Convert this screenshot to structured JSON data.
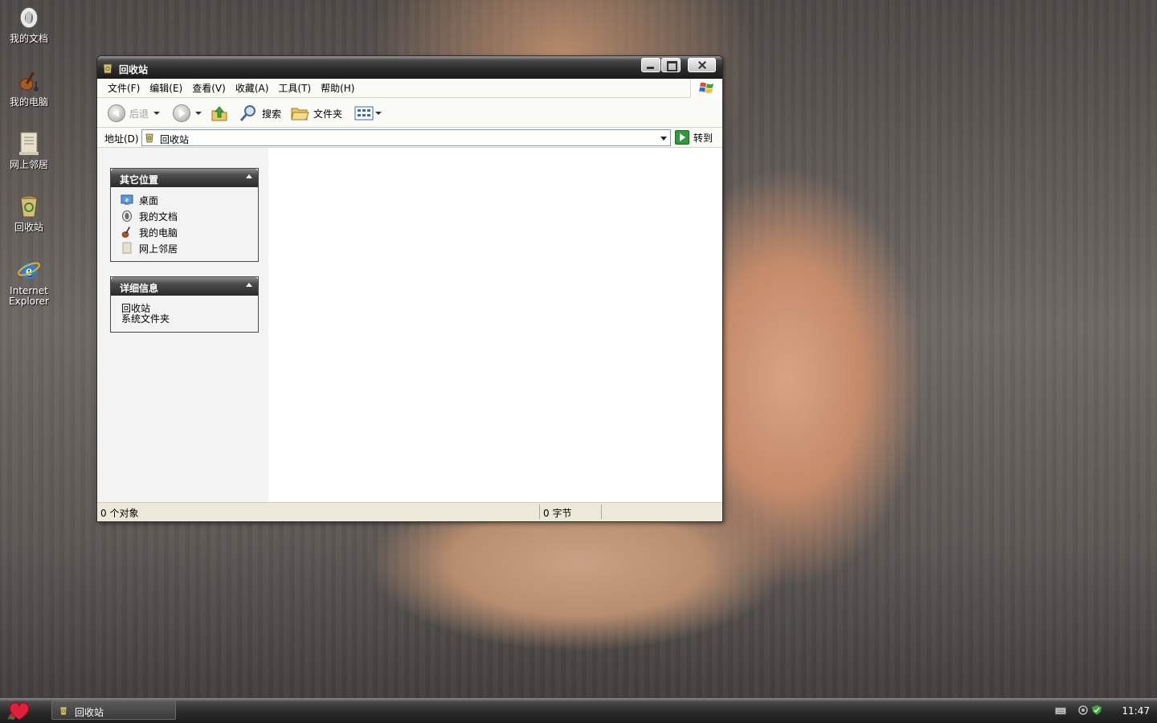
{
  "desktop": {
    "icons": [
      {
        "label": "我的文档",
        "icon": "my-documents-icon"
      },
      {
        "label": "我的电脑",
        "icon": "my-computer-icon"
      },
      {
        "label": "网上邻居",
        "icon": "network-places-icon"
      },
      {
        "label": "回收站",
        "icon": "recycle-bin-icon"
      },
      {
        "label_line1": "Internet",
        "label_line2": "Explorer",
        "icon": "internet-explorer-icon"
      }
    ]
  },
  "window": {
    "title": "回收站",
    "menu": [
      "文件(F)",
      "编辑(E)",
      "查看(V)",
      "收藏(A)",
      "工具(T)",
      "帮助(H)"
    ],
    "toolbar": {
      "back_label": "后退",
      "search_label": "搜索",
      "folders_label": "文件夹"
    },
    "address": {
      "label": "地址(D)",
      "value": "回收站",
      "go_label": "转到"
    },
    "taskpane": {
      "other_places": {
        "title": "其它位置",
        "items": [
          {
            "label": "桌面",
            "icon": "desktop-icon"
          },
          {
            "label": "我的文档",
            "icon": "my-documents-icon"
          },
          {
            "label": "我的电脑",
            "icon": "my-computer-icon"
          },
          {
            "label": "网上邻居",
            "icon": "network-places-icon"
          }
        ]
      },
      "details": {
        "title": "详细信息",
        "name": "回收站",
        "type": "系统文件夹"
      }
    },
    "status": {
      "objects": "0 个对象",
      "size": "0 字节"
    }
  },
  "taskbar": {
    "task_label": "回收站",
    "clock": "11:47"
  },
  "colors": {
    "titlebar": "#2c2c2c",
    "window_bg": "#ece9d8",
    "taskpane_bg": "#f3f3f3",
    "go_green": "#2e9a3a"
  }
}
